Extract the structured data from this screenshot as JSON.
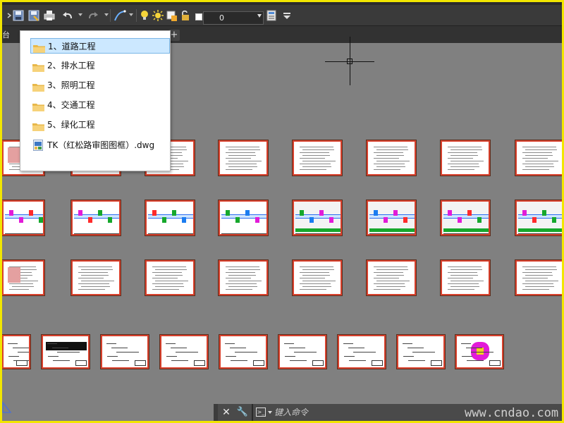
{
  "colors": {
    "frame_border": "#f2e600",
    "canvas_background": "#808080",
    "thumbnail_border": "#d8402c",
    "dropdown_selection": "#cce8ff"
  },
  "toolbar": {
    "icons": [
      "save-icon",
      "save-as-icon",
      "print-icon",
      "undo-icon",
      "redo-icon",
      "polyline-icon",
      "bulb-icon",
      "sun-icon",
      "layer-state-icon",
      "lock-icon",
      "layer-properties-icon",
      "customize-icon"
    ],
    "current_layer": "0"
  },
  "tab_bar": {
    "tab_label": "台",
    "add_tab": "+"
  },
  "file_dropdown": {
    "items": [
      {
        "label": "1、道路工程",
        "icon": "folder-icon",
        "selected": true
      },
      {
        "label": "2、排水工程",
        "icon": "folder-icon",
        "selected": false
      },
      {
        "label": "3、照明工程",
        "icon": "folder-icon",
        "selected": false
      },
      {
        "label": "4、交通工程",
        "icon": "folder-icon",
        "selected": false
      },
      {
        "label": "5、绿化工程",
        "icon": "folder-icon",
        "selected": false
      },
      {
        "label": "TK（红松路审图图框）.dwg",
        "icon": "dwg-file-icon",
        "selected": false
      }
    ]
  },
  "command_line": {
    "close_icon": "✕",
    "settings_icon": "🔧",
    "placeholder": "键入命令"
  },
  "watermark": "www.cndao.com"
}
